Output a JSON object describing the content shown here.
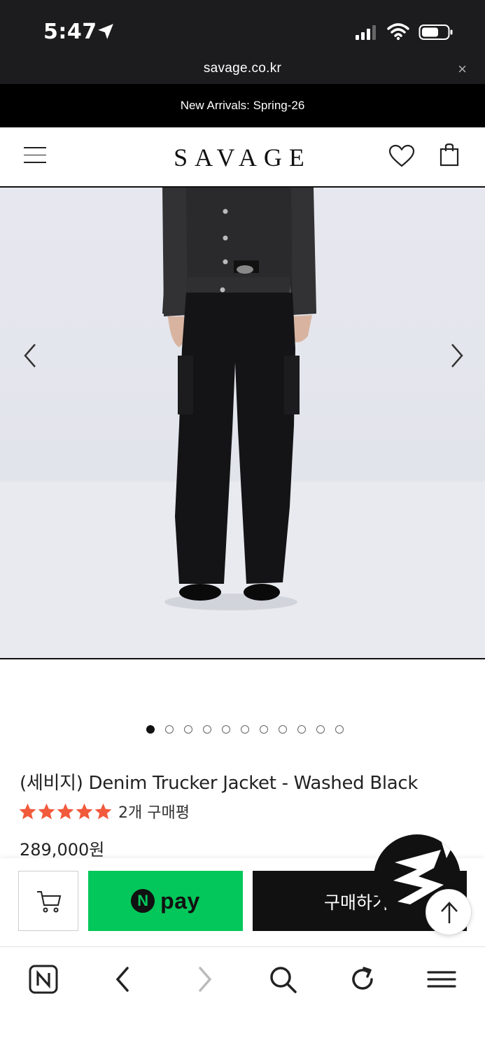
{
  "status_bar": {
    "time": "5:47",
    "icons": [
      "location-arrow-icon",
      "cellular-signal-icon",
      "wifi-icon",
      "battery-icon"
    ]
  },
  "browser": {
    "url": "savage.co.kr",
    "close_glyph": "×"
  },
  "announcement": "New Arrivals: Spring-26",
  "header": {
    "logo": "SAVAGE",
    "icons": [
      "hamburger-menu-icon",
      "heart-icon",
      "shopping-bag-icon"
    ]
  },
  "carousel": {
    "slide_count": 11,
    "active_index": 0,
    "prev_glyph": "‹",
    "next_glyph": "›"
  },
  "product": {
    "title": "(세비지) Denim Trucker Jacket - Washed Black",
    "rating": 5,
    "rating_max": 5,
    "review_label": "2개 구매평",
    "price": "289,000원"
  },
  "purchase_bar": {
    "npay_badge": "N",
    "npay_label": "pay",
    "buy_label": "구매하기"
  },
  "colors": {
    "star": "#f25a3c",
    "npay_green": "#03c75a",
    "status_bar_bg": "#1c1c1e",
    "announcement_bg": "#000000"
  },
  "bottom_toolbar": {
    "icons": [
      "naver-n-icon",
      "back-arrow-icon",
      "forward-arrow-icon",
      "search-icon",
      "refresh-icon",
      "menu-icon"
    ]
  }
}
